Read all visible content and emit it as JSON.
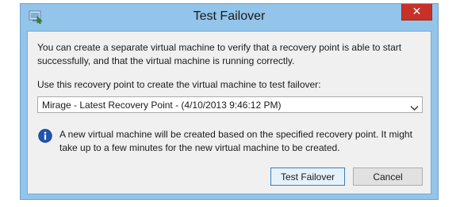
{
  "window": {
    "title": "Test Failover",
    "icon": "app-icon",
    "close_icon": "close-icon",
    "close_glyph": "✕"
  },
  "content": {
    "intro": "You can create a separate virtual machine to verify that a recovery point is able to start successfully, and that the virtual machine is running correctly.",
    "select_label": "Use this recovery point to create the virtual machine to test failover:",
    "recovery_point": {
      "selected": "Mirage - Latest Recovery Point - (4/10/2013 9:46:12 PM)"
    },
    "info_icon": "info-icon",
    "info_text": "A new virtual machine will be created based on the specified recovery point. It might take up to a few minutes for the new virtual machine to be created."
  },
  "buttons": {
    "test_failover": "Test Failover",
    "cancel": "Cancel"
  },
  "colors": {
    "frame": "#93c4ea",
    "close": "#c7312a",
    "client": "#f0f0f0",
    "info": "#1e56b0"
  }
}
